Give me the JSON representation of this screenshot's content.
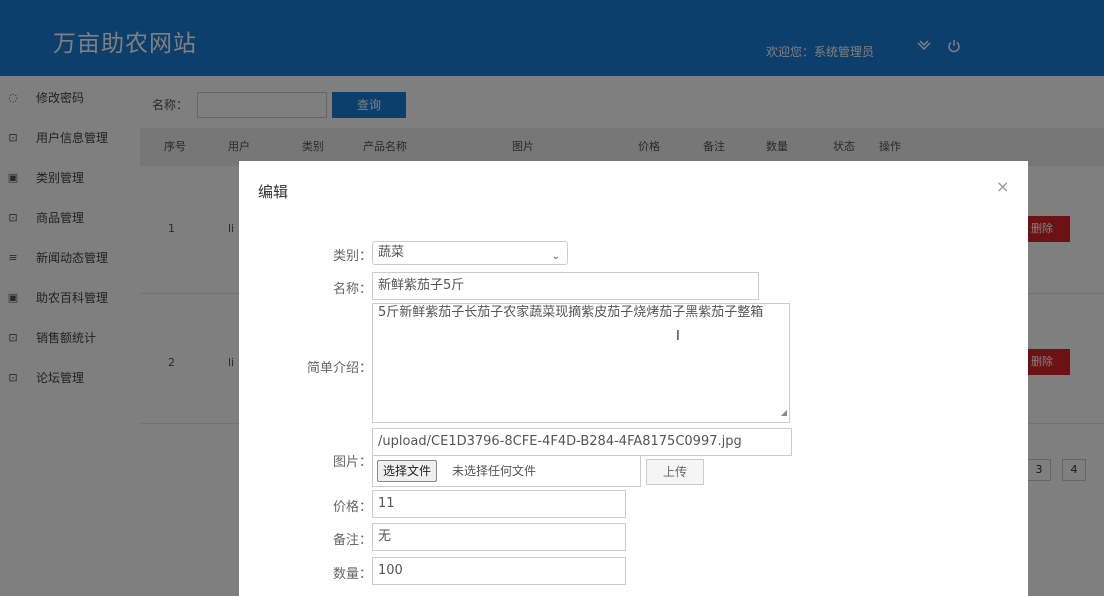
{
  "header": {
    "brand": "万亩助农网站",
    "welcome": "欢迎您：系统管理员"
  },
  "sidebar": {
    "items": [
      {
        "label": "修改密码",
        "icon": "clock-icon"
      },
      {
        "label": "用户信息管理",
        "icon": "image-icon"
      },
      {
        "label": "类别管理",
        "icon": "word-icon"
      },
      {
        "label": "商品管理",
        "icon": "image-icon"
      },
      {
        "label": "新闻动态管理",
        "icon": "list-icon"
      },
      {
        "label": "助农百科管理",
        "icon": "word-icon"
      },
      {
        "label": "销售额统计",
        "icon": "image-icon"
      },
      {
        "label": "论坛管理",
        "icon": "image-icon"
      }
    ]
  },
  "search": {
    "label": "名称：",
    "value": "",
    "button": "查询"
  },
  "table": {
    "headers": [
      "序号",
      "用户",
      "类别",
      "产品名称",
      "图片",
      "价格",
      "备注",
      "数量",
      "状态",
      "操作"
    ],
    "rows": [
      {
        "index": "1",
        "user": "li",
        "delete": "删除"
      },
      {
        "index": "2",
        "user": "li",
        "delete": "删除"
      }
    ]
  },
  "pagination": {
    "pages": [
      "3",
      "4"
    ]
  },
  "modal": {
    "title": "编辑",
    "close": "×",
    "fields": {
      "category_label": "类别：",
      "category_value": "蔬菜",
      "name_label": "名称：",
      "name_value": "新鲜紫茄子5斤",
      "intro_label": "简单介绍：",
      "intro_value": "5斤新鲜紫茄子长茄子农家蔬菜现摘紫皮茄子烧烤茄子黑紫茄子整箱",
      "image_label": "图片：",
      "image_path": "/upload/CE1D3796-8CFE-4F4D-B284-4FA8175C0997.jpg",
      "file_button": "选择文件",
      "file_none": "未选择任何文件",
      "upload_button": "上传",
      "price_label": "价格：",
      "price_value": "11",
      "remark_label": "备注：",
      "remark_value": "无",
      "qty_label": "数量：",
      "qty_value": "100"
    }
  }
}
